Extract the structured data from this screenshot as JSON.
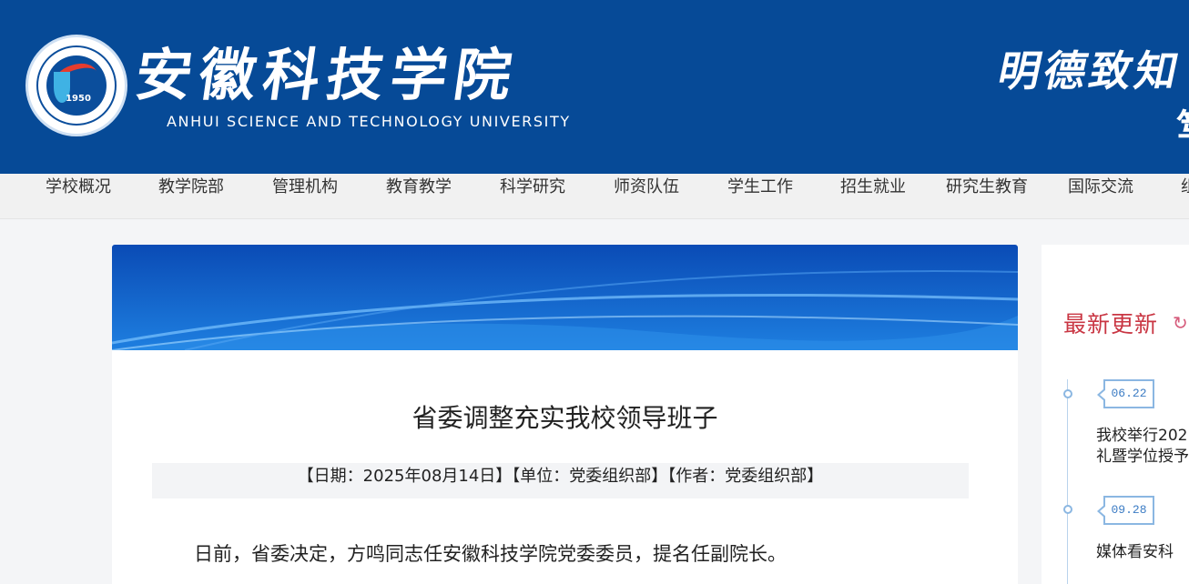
{
  "header": {
    "school_name": "安徽科技学院",
    "school_name_en": "ANHUI SCIENCE AND TECHNOLOGY UNIVERSITY",
    "logo_year": "1950",
    "motto": "明德致知",
    "motto_next_char": "笃",
    "background_color": "#064a97"
  },
  "nav": {
    "items": [
      "学校概况",
      "教学院部",
      "管理机构",
      "教育教学",
      "科学研究",
      "师资队伍",
      "学生工作",
      "招生就业",
      "研究生教育",
      "国际交流",
      "组"
    ]
  },
  "article": {
    "title": "省委调整充实我校领导班子",
    "meta": "【日期：2025年08月14日】【单位：党委组织部】【作者：党委组织部】",
    "paragraph": "日前，省委决定，方鸣同志任安徽科技学院党委委员，提名任副院长。"
  },
  "sidebar": {
    "title": "最新更新",
    "title_color": "#c93643",
    "icon": "refresh-arrow-icon",
    "items": [
      {
        "date": "06.22",
        "line1": "我校举行202",
        "line2": "礼暨学位授予"
      },
      {
        "date": "09.28",
        "line1": "媒体看安科",
        "line2": ""
      }
    ]
  }
}
